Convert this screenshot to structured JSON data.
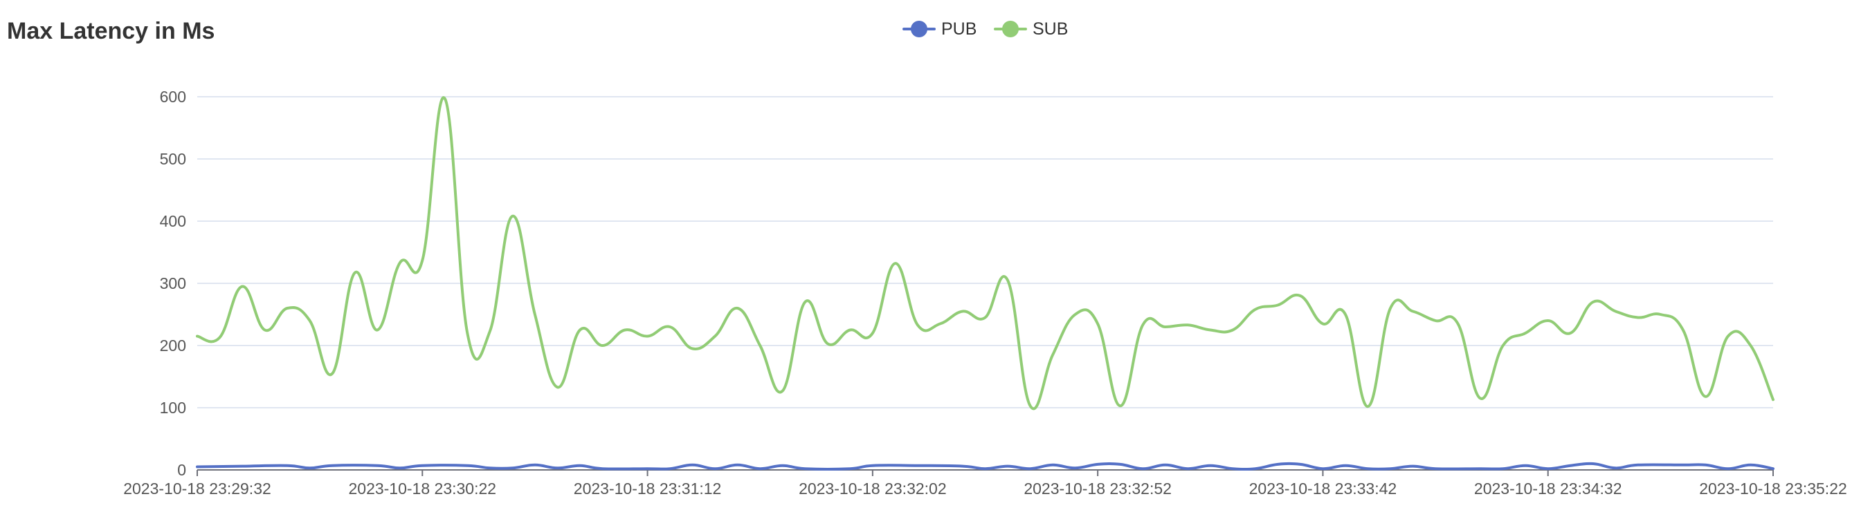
{
  "chart_data": {
    "type": "line",
    "title": "Max Latency in Ms",
    "xlabel": "",
    "ylabel": "",
    "ylim": [
      0,
      600
    ],
    "yticks": [
      "0",
      "100",
      "200",
      "300",
      "400",
      "500",
      "600"
    ],
    "xticks": [
      "2023-10-18 23:29:32",
      "2023-10-18 23:30:22",
      "2023-10-18 23:31:12",
      "2023-10-18 23:32:02",
      "2023-10-18 23:32:52",
      "2023-10-18 23:33:42",
      "2023-10-18 23:34:32",
      "2023-10-18 23:35:22"
    ],
    "x_range_seconds": [
      0,
      350
    ],
    "grid": true,
    "legend_position": "top-center",
    "series": [
      {
        "name": "PUB",
        "color": "#5470c6",
        "points": [
          [
            0,
            5
          ],
          [
            10,
            6
          ],
          [
            20,
            7
          ],
          [
            25,
            3
          ],
          [
            30,
            7
          ],
          [
            40,
            7
          ],
          [
            45,
            3
          ],
          [
            50,
            7
          ],
          [
            60,
            7
          ],
          [
            65,
            3
          ],
          [
            70,
            3
          ],
          [
            75,
            8
          ],
          [
            80,
            3
          ],
          [
            85,
            7
          ],
          [
            90,
            2
          ],
          [
            100,
            2
          ],
          [
            105,
            2
          ],
          [
            110,
            8
          ],
          [
            115,
            2
          ],
          [
            120,
            8
          ],
          [
            125,
            2
          ],
          [
            130,
            7
          ],
          [
            135,
            2
          ],
          [
            145,
            2
          ],
          [
            150,
            7
          ],
          [
            160,
            7
          ],
          [
            170,
            6
          ],
          [
            175,
            2
          ],
          [
            180,
            6
          ],
          [
            185,
            2
          ],
          [
            190,
            8
          ],
          [
            195,
            3
          ],
          [
            200,
            9
          ],
          [
            205,
            9
          ],
          [
            210,
            2
          ],
          [
            215,
            8
          ],
          [
            220,
            2
          ],
          [
            225,
            7
          ],
          [
            230,
            2
          ],
          [
            235,
            2
          ],
          [
            240,
            9
          ],
          [
            245,
            9
          ],
          [
            250,
            2
          ],
          [
            255,
            7
          ],
          [
            260,
            2
          ],
          [
            265,
            2
          ],
          [
            270,
            6
          ],
          [
            275,
            2
          ],
          [
            285,
            2
          ],
          [
            290,
            2
          ],
          [
            295,
            7
          ],
          [
            300,
            2
          ],
          [
            305,
            7
          ],
          [
            310,
            10
          ],
          [
            315,
            3
          ],
          [
            320,
            8
          ],
          [
            330,
            8
          ],
          [
            335,
            8
          ],
          [
            340,
            2
          ],
          [
            345,
            8
          ],
          [
            350,
            2
          ]
        ]
      },
      {
        "name": "SUB",
        "color": "#91cc75",
        "points": [
          [
            0,
            215
          ],
          [
            5,
            213
          ],
          [
            10,
            295
          ],
          [
            15,
            225
          ],
          [
            20,
            260
          ],
          [
            25,
            240
          ],
          [
            30,
            155
          ],
          [
            35,
            317
          ],
          [
            40,
            225
          ],
          [
            45,
            333
          ],
          [
            50,
            337
          ],
          [
            55,
            597
          ],
          [
            60,
            220
          ],
          [
            65,
            223
          ],
          [
            70,
            408
          ],
          [
            75,
            250
          ],
          [
            80,
            133
          ],
          [
            85,
            225
          ],
          [
            90,
            200
          ],
          [
            95,
            225
          ],
          [
            100,
            215
          ],
          [
            105,
            230
          ],
          [
            110,
            195
          ],
          [
            115,
            215
          ],
          [
            120,
            260
          ],
          [
            125,
            200
          ],
          [
            130,
            127
          ],
          [
            135,
            270
          ],
          [
            140,
            203
          ],
          [
            145,
            225
          ],
          [
            150,
            220
          ],
          [
            155,
            332
          ],
          [
            160,
            233
          ],
          [
            165,
            235
          ],
          [
            170,
            255
          ],
          [
            175,
            245
          ],
          [
            180,
            305
          ],
          [
            185,
            103
          ],
          [
            190,
            185
          ],
          [
            195,
            250
          ],
          [
            200,
            235
          ],
          [
            205,
            103
          ],
          [
            210,
            233
          ],
          [
            215,
            230
          ],
          [
            220,
            233
          ],
          [
            225,
            225
          ],
          [
            230,
            225
          ],
          [
            235,
            258
          ],
          [
            240,
            265
          ],
          [
            245,
            280
          ],
          [
            250,
            235
          ],
          [
            255,
            250
          ],
          [
            260,
            102
          ],
          [
            265,
            260
          ],
          [
            270,
            255
          ],
          [
            275,
            240
          ],
          [
            280,
            235
          ],
          [
            285,
            115
          ],
          [
            290,
            200
          ],
          [
            295,
            220
          ],
          [
            300,
            240
          ],
          [
            305,
            220
          ],
          [
            310,
            270
          ],
          [
            315,
            255
          ],
          [
            320,
            245
          ],
          [
            325,
            250
          ],
          [
            330,
            225
          ],
          [
            335,
            118
          ],
          [
            340,
            215
          ],
          [
            345,
            200
          ],
          [
            350,
            113
          ]
        ]
      }
    ]
  }
}
